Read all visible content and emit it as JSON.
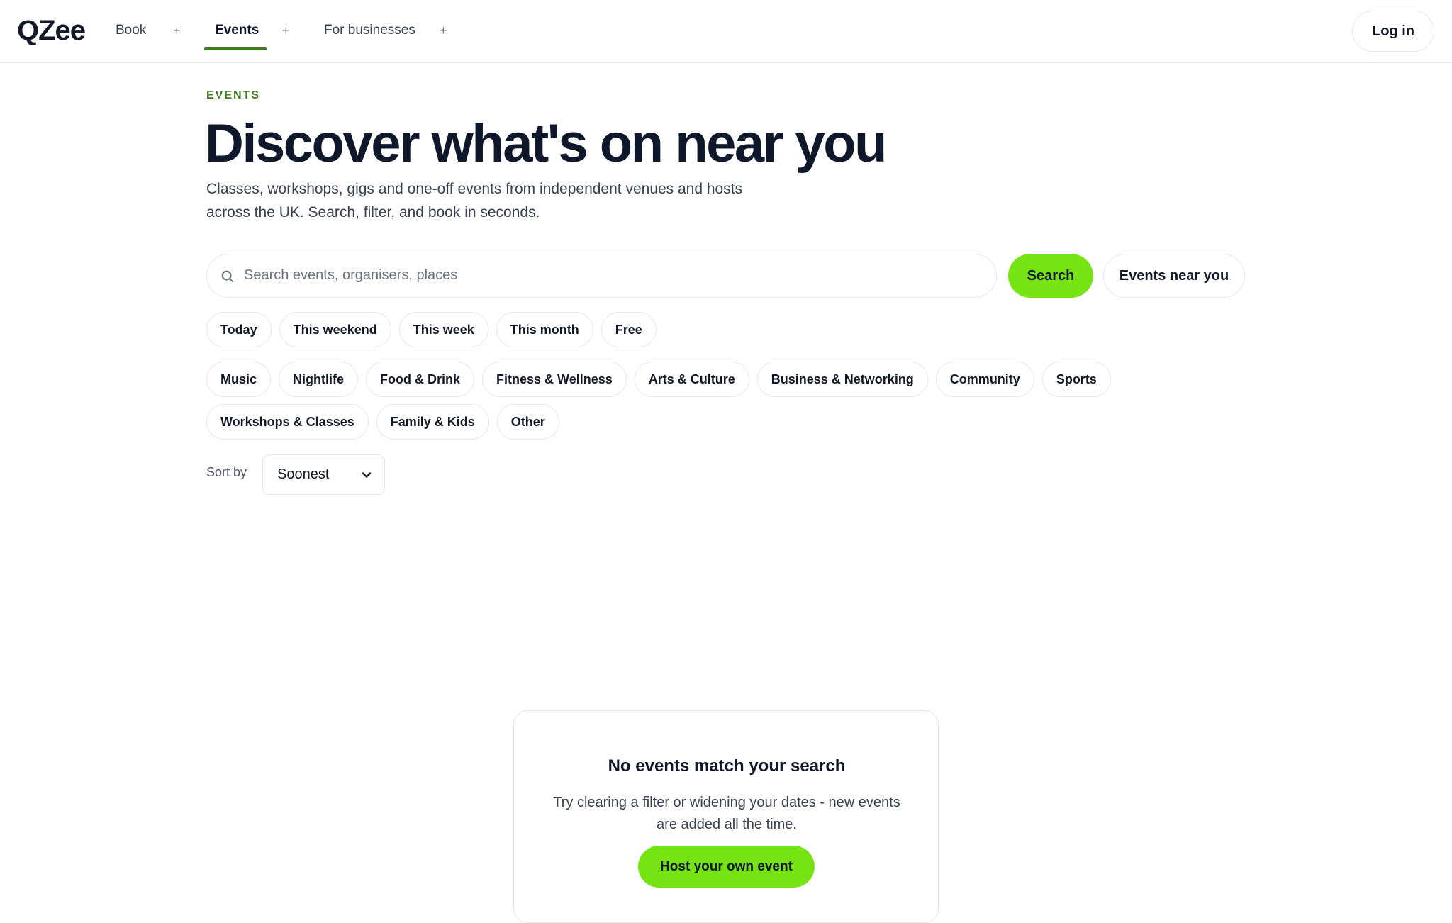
{
  "brand": {
    "logo_text": "QZee"
  },
  "nav": {
    "items": [
      {
        "label": "Book",
        "active": false
      },
      {
        "label": "Events",
        "active": true
      },
      {
        "label": "For businesses",
        "active": false
      }
    ],
    "expand_symbol": "+",
    "login_label": "Log in"
  },
  "hero": {
    "eyebrow": "EVENTS",
    "title": "Discover what's on near you",
    "subtitle": "Classes, workshops, gigs and one-off events from independent venues and hosts across the UK. Search, filter, and book in seconds."
  },
  "search": {
    "placeholder": "Search events, organisers, places",
    "value": "",
    "button_label": "Search",
    "near_label": "Events near you"
  },
  "date_filters": [
    "Today",
    "This weekend",
    "This week",
    "This month",
    "Free"
  ],
  "categories": [
    "Music",
    "Nightlife",
    "Food & Drink",
    "Fitness & Wellness",
    "Arts & Culture",
    "Business & Networking",
    "Community",
    "Sports",
    "Workshops & Classes",
    "Family & Kids",
    "Other"
  ],
  "sort": {
    "label": "Sort by",
    "value": "Soonest"
  },
  "empty_state": {
    "title": "No events match your search",
    "text": "Try clearing a filter or widening your dates - new events are added all the time.",
    "cta_label": "Host your own event"
  },
  "colors": {
    "accent_green": "#76e313",
    "eyebrow_green": "#3f7d1c",
    "text_dark": "#0f172a",
    "border": "#e5e7eb"
  }
}
